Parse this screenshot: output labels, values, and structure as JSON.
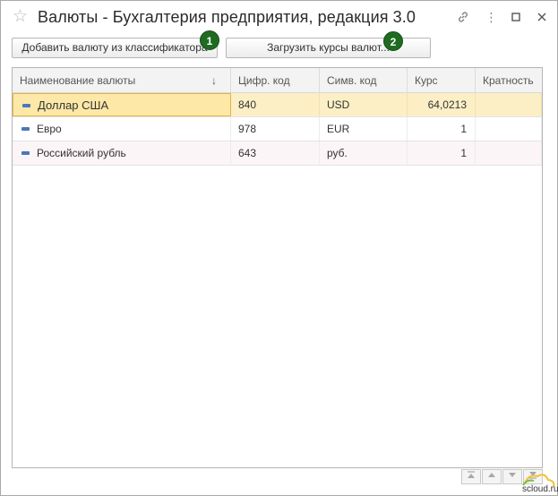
{
  "window": {
    "title": "Валюты - Бухгалтерия предприятия, редакция 3.0",
    "more_glyph": "⋮"
  },
  "toolbar": {
    "add_label": "Добавить валюту из классификатора",
    "load_label": "Загрузить курсы валют...",
    "badge_1": "1",
    "badge_2": "2"
  },
  "table": {
    "columns": [
      "Наименование валюты",
      "Цифр. код",
      "Симв. код",
      "Курс",
      "Кратность"
    ],
    "sort_indicator": "↓",
    "rows": [
      {
        "name": "Доллар США",
        "code": "840",
        "symbol": "USD",
        "rate": "64,0213",
        "multiplicity": ""
      },
      {
        "name": "Евро",
        "code": "978",
        "symbol": "EUR",
        "rate": "1",
        "multiplicity": ""
      },
      {
        "name": "Российский рубль",
        "code": "643",
        "symbol": "руб.",
        "rate": "1",
        "multiplicity": ""
      }
    ]
  },
  "footer": {
    "brand": "scloud.ru"
  },
  "colors": {
    "badge": "#1e6b21",
    "selected_row": "#fcefc6",
    "selected_cell_border": "#e3b34a",
    "row_icon": "#4a78b8"
  }
}
